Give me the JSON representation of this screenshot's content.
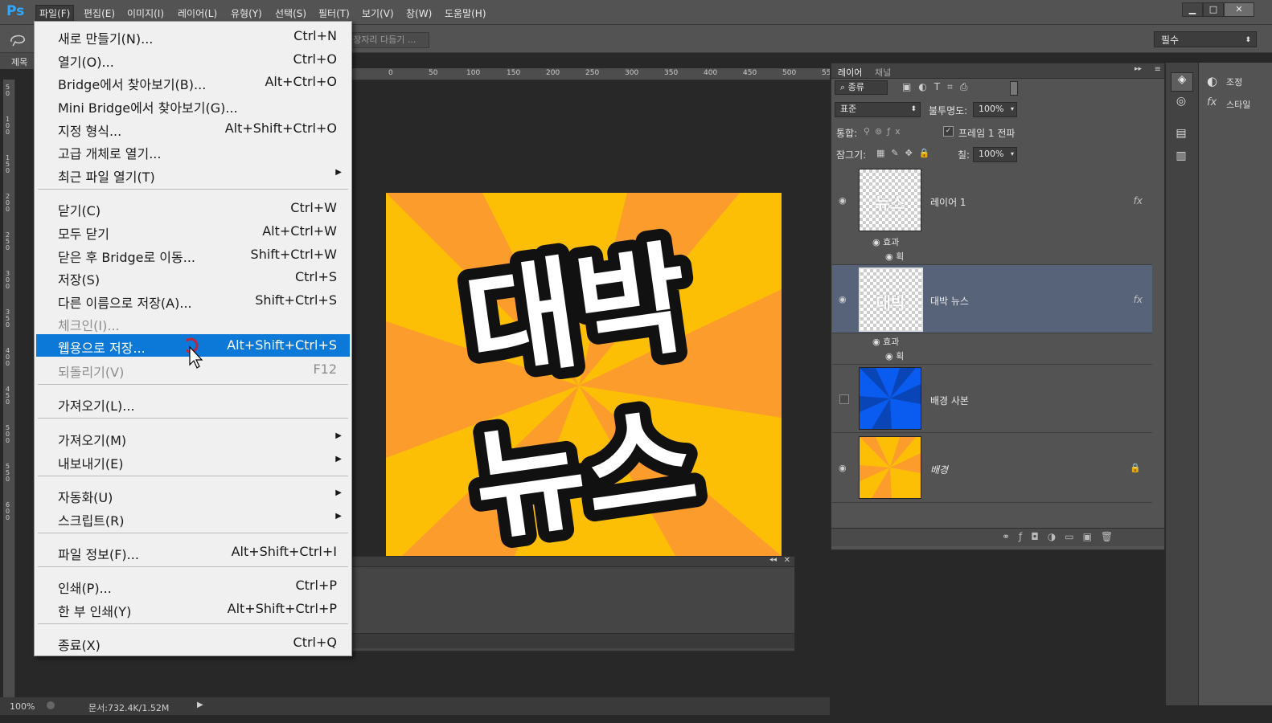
{
  "app": {
    "logo": "Ps"
  },
  "menubar": {
    "items": [
      "파일(F)",
      "편집(E)",
      "이미지(I)",
      "레이어(L)",
      "유형(Y)",
      "선택(S)",
      "필터(T)",
      "보기(V)",
      "창(W)",
      "도움말(H)"
    ]
  },
  "window_controls": {
    "minimize": "▁",
    "maximize": "□",
    "close": "✕"
  },
  "options_bar": {
    "refine_edge": "가장자리 다듬기 ...",
    "workspace": "필수"
  },
  "document": {
    "tab_label": "제목",
    "canvas_text_line1": "대박",
    "canvas_text_line2": "뉴스",
    "ruler_top_labels": [
      "0",
      "50",
      "100",
      "150",
      "200",
      "250",
      "300",
      "350",
      "400",
      "450",
      "500",
      "55"
    ],
    "ruler_left_labels": [
      "50",
      "100",
      "150",
      "200",
      "250",
      "300",
      "350",
      "400",
      "450",
      "500",
      "550",
      "600"
    ]
  },
  "status_bar": {
    "zoom": "100%",
    "doc_info": "문서:732.4K/1.52M"
  },
  "file_menu": {
    "items": [
      {
        "label": "새로 만들기(N)...",
        "shortcut": "Ctrl+N"
      },
      {
        "label": "열기(O)...",
        "shortcut": "Ctrl+O"
      },
      {
        "label": "Bridge에서 찾아보기(B)...",
        "shortcut": "Alt+Ctrl+O"
      },
      {
        "label": "Mini Bridge에서 찾아보기(G)...",
        "shortcut": ""
      },
      {
        "label": "지정 형식...",
        "shortcut": "Alt+Shift+Ctrl+O"
      },
      {
        "label": "고급 개체로 열기...",
        "shortcut": ""
      },
      {
        "label": "최근 파일 열기(T)",
        "shortcut": ""
      },
      {
        "label": "닫기(C)",
        "shortcut": "Ctrl+W"
      },
      {
        "label": "모두 닫기",
        "shortcut": "Alt+Ctrl+W"
      },
      {
        "label": "닫은 후 Bridge로 이동...",
        "shortcut": "Shift+Ctrl+W"
      },
      {
        "label": "저장(S)",
        "shortcut": "Ctrl+S"
      },
      {
        "label": "다른 이름으로 저장(A)...",
        "shortcut": "Shift+Ctrl+S"
      },
      {
        "label": "체크인(I)...",
        "shortcut": ""
      },
      {
        "label": "웹용으로 저장...",
        "shortcut": "Alt+Shift+Ctrl+S"
      },
      {
        "label": "되돌리기(V)",
        "shortcut": "F12"
      },
      {
        "label": "가져오기(L)...",
        "shortcut": ""
      },
      {
        "label": "가져오기(M)",
        "shortcut": ""
      },
      {
        "label": "내보내기(E)",
        "shortcut": ""
      },
      {
        "label": "자동화(U)",
        "shortcut": ""
      },
      {
        "label": "스크립트(R)",
        "shortcut": ""
      },
      {
        "label": "파일 정보(F)...",
        "shortcut": "Alt+Shift+Ctrl+I"
      },
      {
        "label": "인쇄(P)...",
        "shortcut": "Ctrl+P"
      },
      {
        "label": "한 부 인쇄(Y)",
        "shortcut": "Alt+Shift+Ctrl+P"
      },
      {
        "label": "종료(X)",
        "shortcut": "Ctrl+Q"
      }
    ]
  },
  "layers_panel": {
    "tabs": [
      "레이어",
      "채널"
    ],
    "filter_kind": "종류",
    "blend_mode": "표준",
    "opacity_label": "불투명도:",
    "opacity_value": "100%",
    "unify_label": "통합:",
    "propagate_label": "프레임 1 전파",
    "lock_label": "잠그기:",
    "fill_label": "칠:",
    "fill_value": "100%",
    "effects_label": "효과",
    "stroke_label": "획",
    "fx": "fx",
    "layers": [
      {
        "name": "레이어 1",
        "thumb_text": "뉴스"
      },
      {
        "name": "대박 뉴스",
        "thumb_text": "대박"
      },
      {
        "name": "배경 사본"
      },
      {
        "name": "배경"
      }
    ]
  },
  "adjust_panel": {
    "adjustments": "조정",
    "styles": "스타일"
  },
  "colors": {
    "canvas_orange": "#fb9c2d",
    "canvas_yellow": "#fcbf05",
    "blue_layer": "#0a5cf0",
    "menu_highlight": "#0c78d7",
    "selected_layer": "#576379"
  }
}
